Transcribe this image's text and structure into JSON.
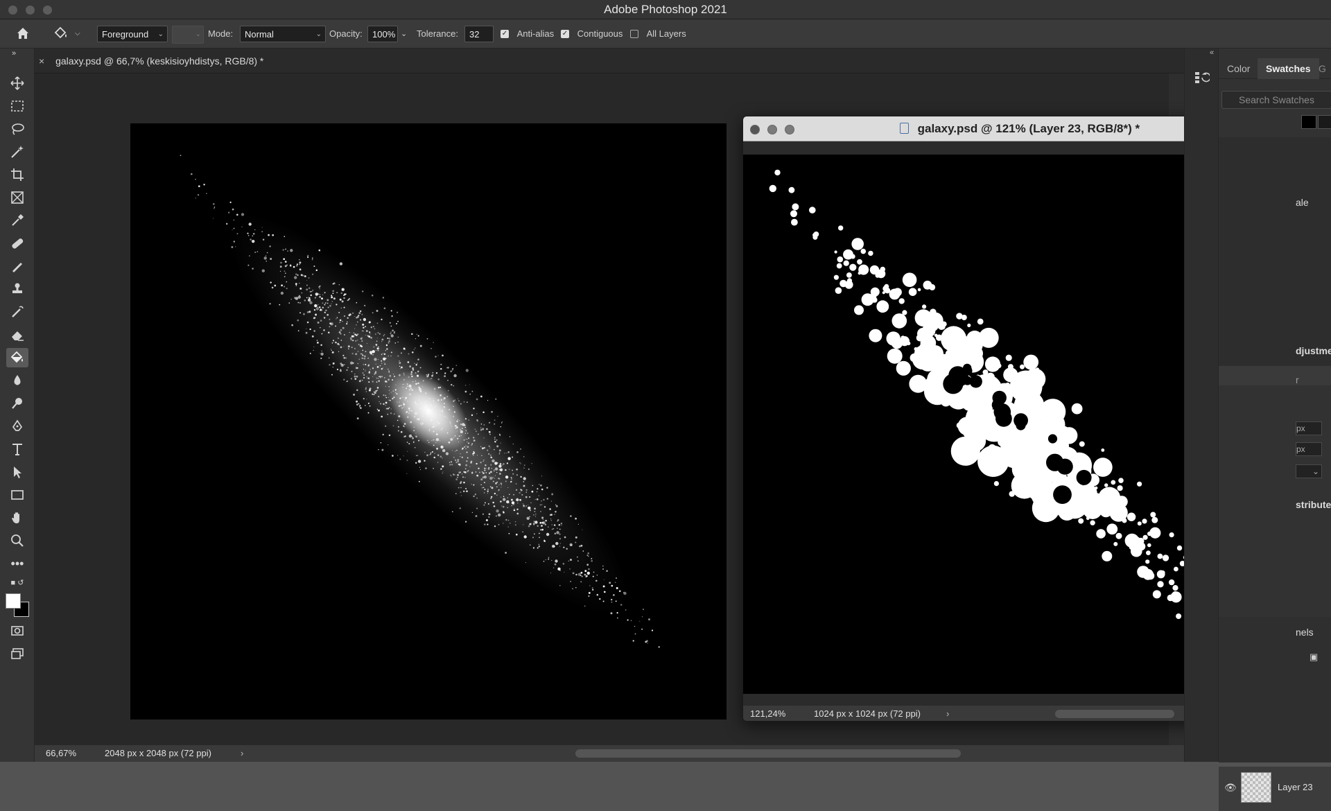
{
  "app": {
    "title": "Adobe Photoshop 2021"
  },
  "options_bar": {
    "fill_source": "Foreground",
    "mode_label": "Mode:",
    "mode_value": "Normal",
    "opacity_label": "Opacity:",
    "opacity_value": "100%",
    "tolerance_label": "Tolerance:",
    "tolerance_value": "32",
    "anti_alias_label": "Anti-alias",
    "anti_alias_checked": true,
    "contiguous_label": "Contiguous",
    "contiguous_checked": true,
    "all_layers_label": "All Layers",
    "all_layers_checked": false
  },
  "toolbar": {
    "tools": [
      "move-icon",
      "marquee-icon",
      "lasso-icon",
      "magic-wand-icon",
      "crop-icon",
      "frame-icon",
      "eyedropper-icon",
      "healing-brush-icon",
      "brush-icon",
      "clone-stamp-icon",
      "history-brush-icon",
      "eraser-icon",
      "paint-bucket-icon",
      "blur-icon",
      "dodge-icon",
      "pen-icon",
      "type-icon",
      "path-selection-icon",
      "rectangle-icon",
      "hand-icon",
      "zoom-icon",
      "more-tools-icon"
    ],
    "active_tool": "paint-bucket-icon",
    "foreground_color": "#ffffff",
    "background_color": "#000000"
  },
  "document_tab": {
    "title": "galaxy.psd @ 66,7% (keskisioyhdistys, RGB/8) *"
  },
  "main_status": {
    "zoom": "66,67%",
    "size": "2048 px x 2048 px (72 ppi)"
  },
  "floating_window": {
    "title": "galaxy.psd @ 121% (Layer 23, RGB/8*) *",
    "zoom": "121,24%",
    "size": "1024 px x 1024 px (72 ppi)"
  },
  "right_panel": {
    "tabs": [
      "Color",
      "Swatches"
    ],
    "active_tab": "Swatches",
    "search_placeholder": "Search Swatches",
    "partial_labels": [
      "ale",
      "djustme",
      "r",
      "px",
      "px",
      "stribute",
      "nels"
    ],
    "layer_name": "Layer 23"
  },
  "colors": {
    "accent": "#ffffff",
    "canvas": "#000000",
    "chrome": "#353535"
  }
}
